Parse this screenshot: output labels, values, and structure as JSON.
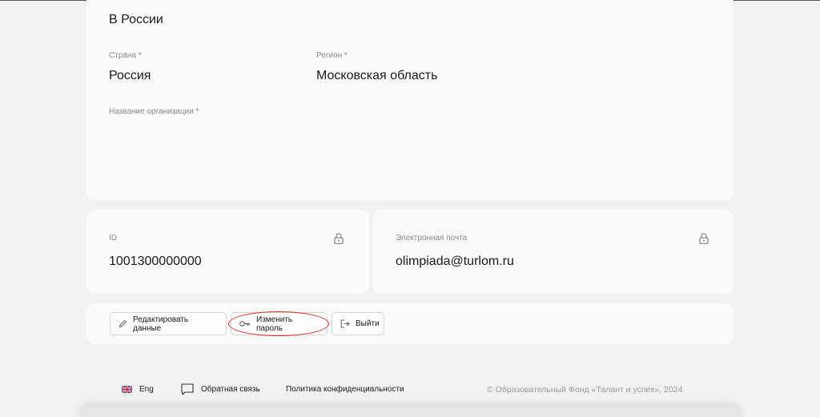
{
  "location_card": {
    "title": "В России",
    "country_label": "Страна *",
    "country_value": "Россия",
    "region_label": "Регион *",
    "region_value": "Московская область",
    "org_label": "Название организации *"
  },
  "id_card": {
    "label": "ID",
    "value": "1001300000000",
    "icon": "lock-icon"
  },
  "email_card": {
    "label": "Электронная почта",
    "value": "olimpiada@turlom.ru",
    "icon": "lock-icon"
  },
  "actions": {
    "edit_label": "Редактировать данные",
    "change_password_label": "Изменить пароль",
    "logout_label": "Выйти",
    "highlight_color": "#d9342b"
  },
  "footer": {
    "language_label": "Eng",
    "feedback_label": "Обратная связь",
    "privacy_label": "Политика конфиденциальности",
    "copyright": "© Образовательный Фонд «Талант и успех», 2024"
  }
}
